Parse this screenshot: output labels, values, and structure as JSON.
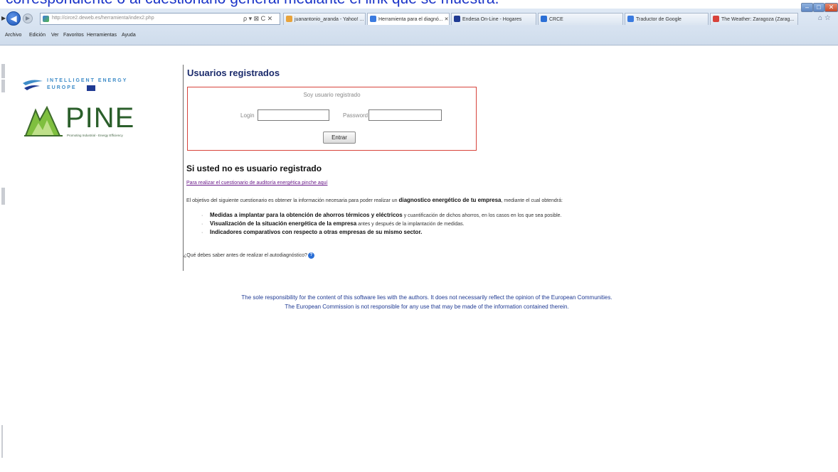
{
  "caption": "correspondiente o al cuestionario general mediante el link que se muestra.",
  "browser": {
    "url": "http://circe2.deweb.es/herramienta/index2.php",
    "address_tools": "ρ ▾ ⊠ C ✕",
    "tabs": [
      {
        "label": "juanantonio_aranda - Yahoo! ...",
        "icon_color": "#e8a33b"
      },
      {
        "label": "Herramienta para el diagnó... ✕",
        "icon_color": "#3b7be0",
        "active": true
      },
      {
        "label": "Endesa On-Line - Hogares",
        "icon_color": "#1f3a93"
      },
      {
        "label": "CRCE",
        "icon_color": "#2b6fd6"
      },
      {
        "label": "Traductor de Google",
        "icon_color": "#3b7be0"
      },
      {
        "label": "The Weather: Zaragoza (Zarag...",
        "icon_color": "#d8433b"
      }
    ],
    "menu": [
      "Archivo",
      "Edición",
      "Ver",
      "Favoritos",
      "Herramientas",
      "Ayuda"
    ],
    "window_controls": {
      "minimize": "–",
      "maximize": "□",
      "close": "✕"
    },
    "toolbar_icons": "⌂ ☆"
  },
  "logos": {
    "iee_line1": "INTELLIGENT ENERGY",
    "iee_line2": "EUROPE",
    "pine_word": "PINE",
    "pine_tagline": "Promoting Industrial - Energy Efficiency"
  },
  "login": {
    "title": "Usuarios registrados",
    "caption": "Soy usuario registrado",
    "login_label": "Login",
    "login_value": "",
    "password_label": "Password",
    "password_value": "",
    "submit_label": "Entrar"
  },
  "unregistered": {
    "title": "Si usted no es usuario registrado",
    "link_text": "Para realizar el cuestionario de auditoría energética pinche aquí",
    "intro_start": "El objetivo del siguiente cuestionario es obtener la información necesaria para poder realizar un ",
    "intro_bold": "diagnostico energético de tu empresa",
    "intro_end": ", mediante el cual obtendrá:",
    "bullets": [
      {
        "bold": "Medidas a implantar para la obtención de ahorros térmicos y eléctricos",
        "rest": " y cuantificación de dichos ahorros, en los casos en los que sea posible."
      },
      {
        "bold": "Visualización de la situación energética de la empresa",
        "rest": " antes y después de la implantación de medidas."
      },
      {
        "bold": "Indicadores comparativos con respecto a otras empresas de su mismo sector.",
        "rest": ""
      }
    ],
    "question": "¿Qué debes saber antes de realizar el autodiagnóstico?",
    "help_icon": "?"
  },
  "disclaimer": {
    "line1": "The sole responsibility for the content of this software lies with the authors. It does not necessarily reflect the opinion of the European Communities.",
    "line2": "The European Commission is not responsible for any use that may be made of the information contained therein."
  }
}
